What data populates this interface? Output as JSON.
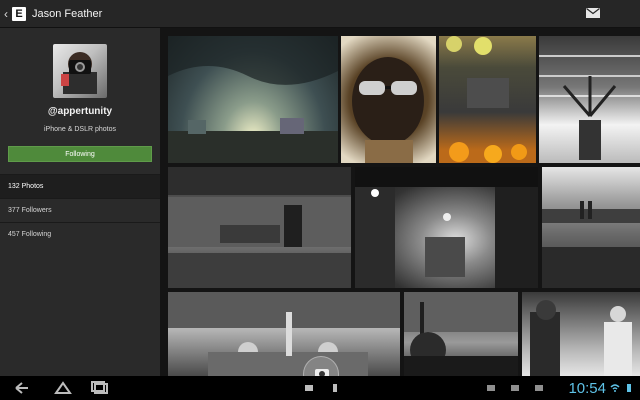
{
  "app": {
    "title": "Jason Feather",
    "logo_letter": "E"
  },
  "profile": {
    "handle": "@appertunity",
    "bio": "iPhone & DSLR photos",
    "following_label": "Following"
  },
  "stats": [
    {
      "label": "132 Photos",
      "active": true
    },
    {
      "label": "377  Followers",
      "active": false
    },
    {
      "label": "457 Following",
      "active": false
    }
  ],
  "system": {
    "clock": "10:54"
  },
  "colors": {
    "following_button": "#4f8a3b",
    "clock": "#5ec2e7"
  },
  "icons": {
    "back": "chevron-left-icon",
    "mail": "envelope-icon",
    "nav_back": "back-arrow-icon",
    "nav_home": "home-icon",
    "nav_recents": "recent-apps-icon"
  }
}
